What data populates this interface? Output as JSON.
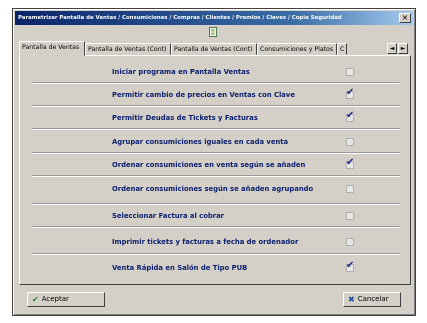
{
  "window": {
    "title": "Parametrizar Pantalla de Ventas / Consumiciones / Compras / Clientes / Premios / Claves / Copia Seguridad",
    "close_glyph": "×"
  },
  "toolbar": {
    "icon": "document-icon"
  },
  "tabs": [
    {
      "label": "Pantalla de Ventas",
      "active": true
    },
    {
      "label": "Pantalla de Ventas (Cont)",
      "active": false
    },
    {
      "label": "Pantalla de Ventas (Cont)",
      "active": false
    },
    {
      "label": "Consumiciones y Platos",
      "active": false
    },
    {
      "label": "C",
      "active": false
    }
  ],
  "tab_scroll": {
    "left": "◄",
    "right": "►"
  },
  "options": [
    {
      "label": "Iniciar programa en Pantalla Ventas",
      "checked": false
    },
    {
      "label": "Permitir cambio de precios en Ventas con Clave",
      "checked": true
    },
    {
      "label": "Permitir Deudas de Tickets y Facturas",
      "checked": true
    },
    {
      "label": "Agrupar consumiciones iguales en cada venta",
      "checked": false
    },
    {
      "label": "Ordenar consumiciones en venta según se añaden",
      "checked": true
    },
    {
      "label": "Ordenar consumiciones según se añaden agrupando",
      "checked": false
    },
    {
      "label": "Seleccionar Factura al cobrar",
      "checked": false
    },
    {
      "label": "Imprimir tickets y facturas a fecha de ordenador",
      "checked": false
    },
    {
      "label": "Venta Rápida en Salón de Tipo PUB",
      "checked": true
    }
  ],
  "check_glyph": "✔",
  "buttons": {
    "accept_label": "Aceptar",
    "accept_icon": "✔",
    "cancel_label": "Cancelar",
    "cancel_icon": "✖"
  }
}
